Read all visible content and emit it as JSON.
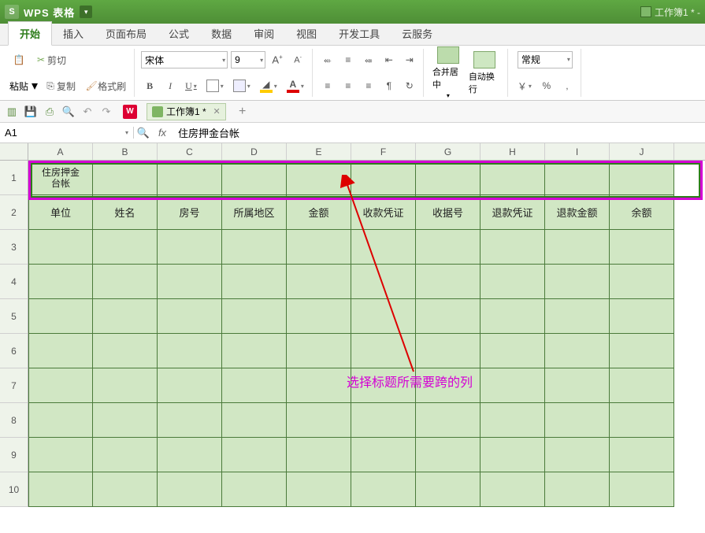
{
  "app": {
    "brand": "WPS 表格",
    "doc_title": "工作簿1 * -"
  },
  "menutabs": [
    "开始",
    "插入",
    "页面布局",
    "公式",
    "数据",
    "审阅",
    "视图",
    "开发工具",
    "云服务"
  ],
  "clipboard": {
    "paste": "粘贴",
    "cut": "剪切",
    "copy": "复制",
    "format_painter": "格式刷"
  },
  "font": {
    "name": "宋体",
    "size": "9"
  },
  "align": {
    "merge_center": "合并居中",
    "wrap_text": "自动换行"
  },
  "numfmt": {
    "general": "常规",
    "currency": "￥",
    "percent": "%",
    "comma": ","
  },
  "doc_tab": {
    "name": "工作簿1 *"
  },
  "namebox": "A1",
  "formula": "住房押金台帐",
  "columns": [
    "A",
    "B",
    "C",
    "D",
    "E",
    "F",
    "G",
    "H",
    "I",
    "J"
  ],
  "rows": [
    "1",
    "2",
    "3",
    "4",
    "5",
    "6",
    "7",
    "8",
    "9",
    "10"
  ],
  "row1_text_l1": "住房押金",
  "row1_text_l2": "台帐",
  "headers": [
    "单位",
    "姓名",
    "房号",
    "所属地区",
    "金额",
    "收款凭证",
    "收据号",
    "退款凭证",
    "退款金额",
    "余额"
  ],
  "annotation_text": "选择标题所需要跨的列"
}
